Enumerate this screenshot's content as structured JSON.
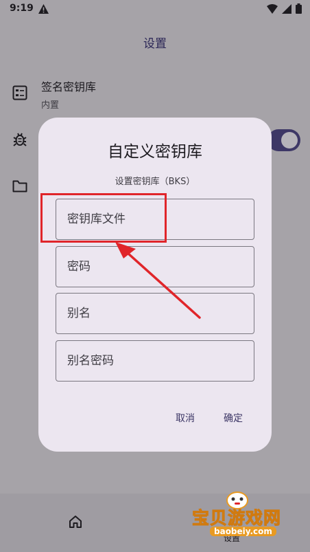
{
  "status_bar": {
    "time": "9:19"
  },
  "app_bar": {
    "title": "设置"
  },
  "settings": {
    "keystore": {
      "title": "签名密钥库",
      "subtitle": "内置"
    }
  },
  "dialog": {
    "title": "自定义密钥库",
    "subtitle": "设置密钥库（BKS）",
    "fields": {
      "keystore_file": {
        "placeholder": "密钥库文件"
      },
      "password": {
        "placeholder": "密码"
      },
      "alias": {
        "placeholder": "别名"
      },
      "alias_password": {
        "placeholder": "别名密码"
      }
    },
    "cancel_label": "取消",
    "confirm_label": "确定"
  },
  "bottom_nav": {
    "partial_label": "设置"
  },
  "watermark": {
    "text": "宝贝游戏网",
    "url": "baobeiy.com"
  },
  "colors": {
    "accent": "#3d3766",
    "highlight": "#e0252a",
    "dialog_bg": "#ece6f0",
    "scrim": "#a6a3a8"
  }
}
